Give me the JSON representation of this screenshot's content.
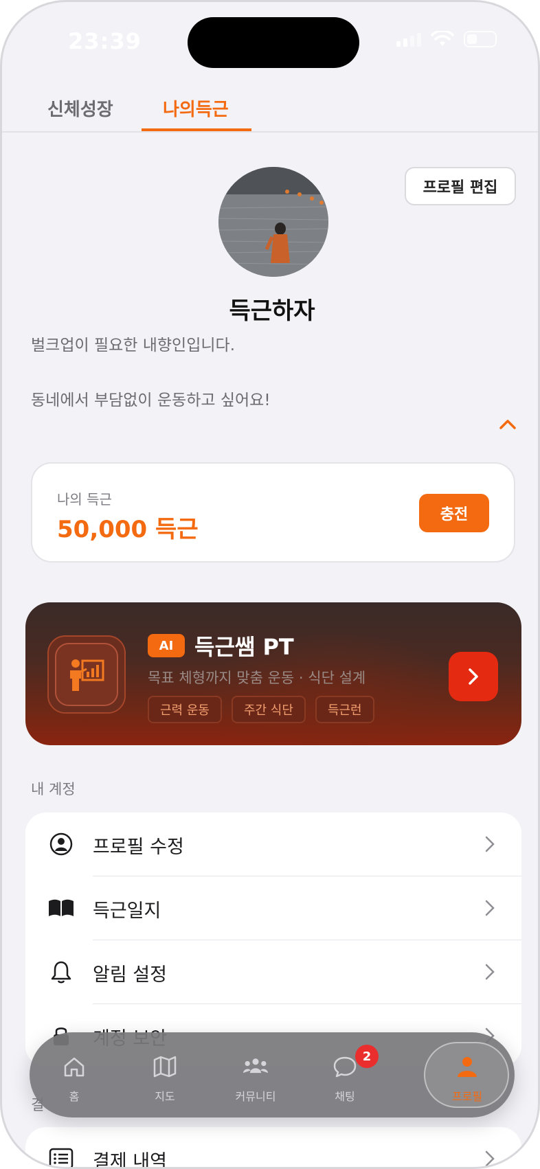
{
  "status_bar": {
    "time": "23:39"
  },
  "tabs": [
    {
      "label": "신체성장",
      "active": false
    },
    {
      "label": "나의득근",
      "active": true
    }
  ],
  "profile": {
    "edit_label": "프로필 편집",
    "nickname": "득근하자",
    "bio_line1": "벌크업이 필요한 내향인입니다.",
    "bio_line2": "동네에서 부담없이 운동하고 싶어요!"
  },
  "points": {
    "label": "나의 득근",
    "value": "50,000 득근",
    "charge_label": "충전"
  },
  "ai_banner": {
    "badge": "AI",
    "title": "득근쌤 PT",
    "description": "목표 체형까지 맞춤 운동 · 식단 설계",
    "tags": [
      "근력 운동",
      "주간 식단",
      "득근런"
    ]
  },
  "account_section": {
    "label": "내 계정",
    "items": [
      {
        "label": "프로필 수정",
        "icon": "user-circle-icon"
      },
      {
        "label": "득근일지",
        "icon": "book-icon"
      },
      {
        "label": "알림 설정",
        "icon": "bell-icon"
      },
      {
        "label": "계정 보안",
        "icon": "lock-icon"
      }
    ]
  },
  "payment_section": {
    "label": "결",
    "items": [
      {
        "label": "결제 내역",
        "icon": "receipt-list-icon"
      }
    ]
  },
  "bottom_nav": {
    "items": [
      {
        "label": "홈",
        "icon": "home-icon"
      },
      {
        "label": "지도",
        "icon": "map-icon"
      },
      {
        "label": "커뮤니티",
        "icon": "community-icon"
      },
      {
        "label": "채팅",
        "icon": "chat-icon",
        "badge": "2"
      },
      {
        "label": "프로필",
        "icon": "profile-icon",
        "active": true
      }
    ]
  },
  "colors": {
    "accent": "#f36a10",
    "badge": "#ea2e2e",
    "banner": "#4a2a22"
  }
}
